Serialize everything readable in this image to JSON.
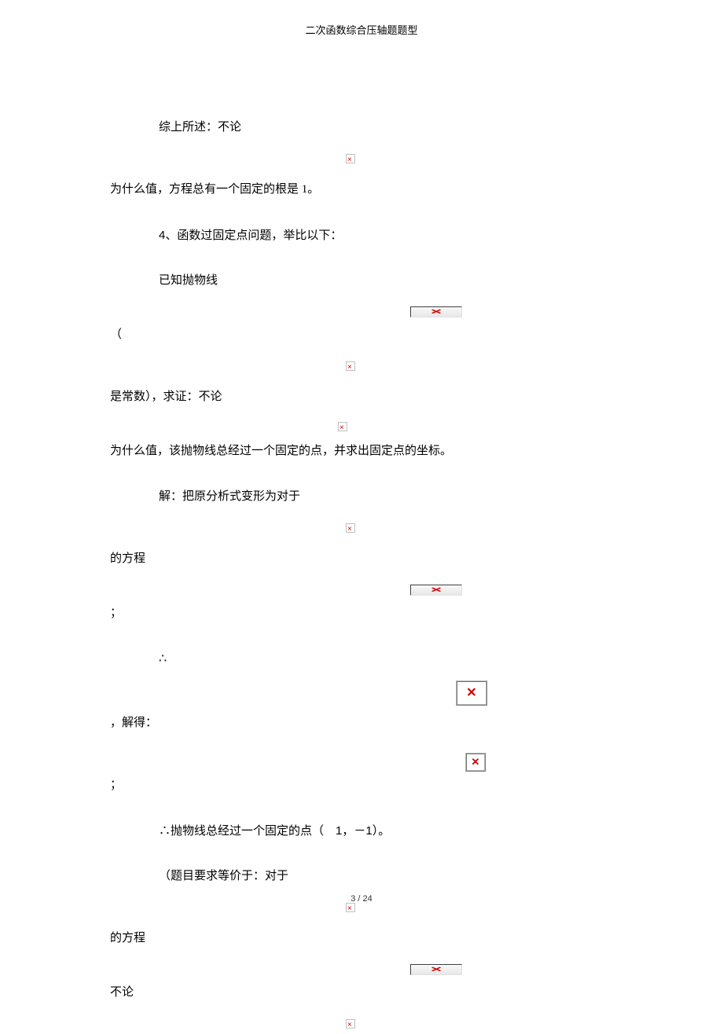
{
  "header": {
    "title": "二次函数综合压轴题题型"
  },
  "body": {
    "l1": "综上所述：不论",
    "l2": "为什么值，方程总有一个固定的根是 1。",
    "l3_a": "4",
    "l3_b": "、函数过固定点问题，举比以下：",
    "l4": "已知抛物线",
    "l5": "（",
    "l6": "是常数），求证：不论",
    "l7": "为什么值，该抛物线总经过一个固定的点，并求出固定点的坐标。",
    "l8": "解：把原分析式变形为对于",
    "l9": "的方程",
    "l10": "；",
    "l11": "∴",
    "l12": "，解得：",
    "l13": "；",
    "l14_a": "∴抛物线总经过一个固定的点（",
    "l14_b": "1",
    "l14_c": "，－",
    "l14_d": "1",
    "l14_e": "）。",
    "l15": "（题目要求等价于：对于",
    "l16": "的方程",
    "l17": "不论"
  },
  "footer": {
    "page": "3",
    "total": "24",
    "sep": "/"
  }
}
